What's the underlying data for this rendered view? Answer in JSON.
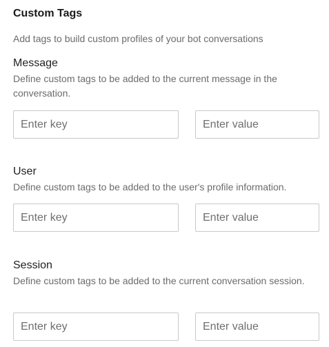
{
  "header": {
    "title": "Custom Tags",
    "subtitle": "Add tags to build custom profiles of your bot conversations"
  },
  "sections": [
    {
      "heading": "Message",
      "description": "Define custom tags to be added to the current message in the conversation.",
      "key_placeholder": "Enter key",
      "value_placeholder": "Enter value"
    },
    {
      "heading": "User",
      "description": "Define custom tags to be added to the user's profile information.",
      "key_placeholder": "Enter key",
      "value_placeholder": "Enter value"
    },
    {
      "heading": "Session",
      "description": "Define custom tags to be added to the current conversation session.",
      "key_placeholder": "Enter key",
      "value_placeholder": "Enter value"
    }
  ]
}
